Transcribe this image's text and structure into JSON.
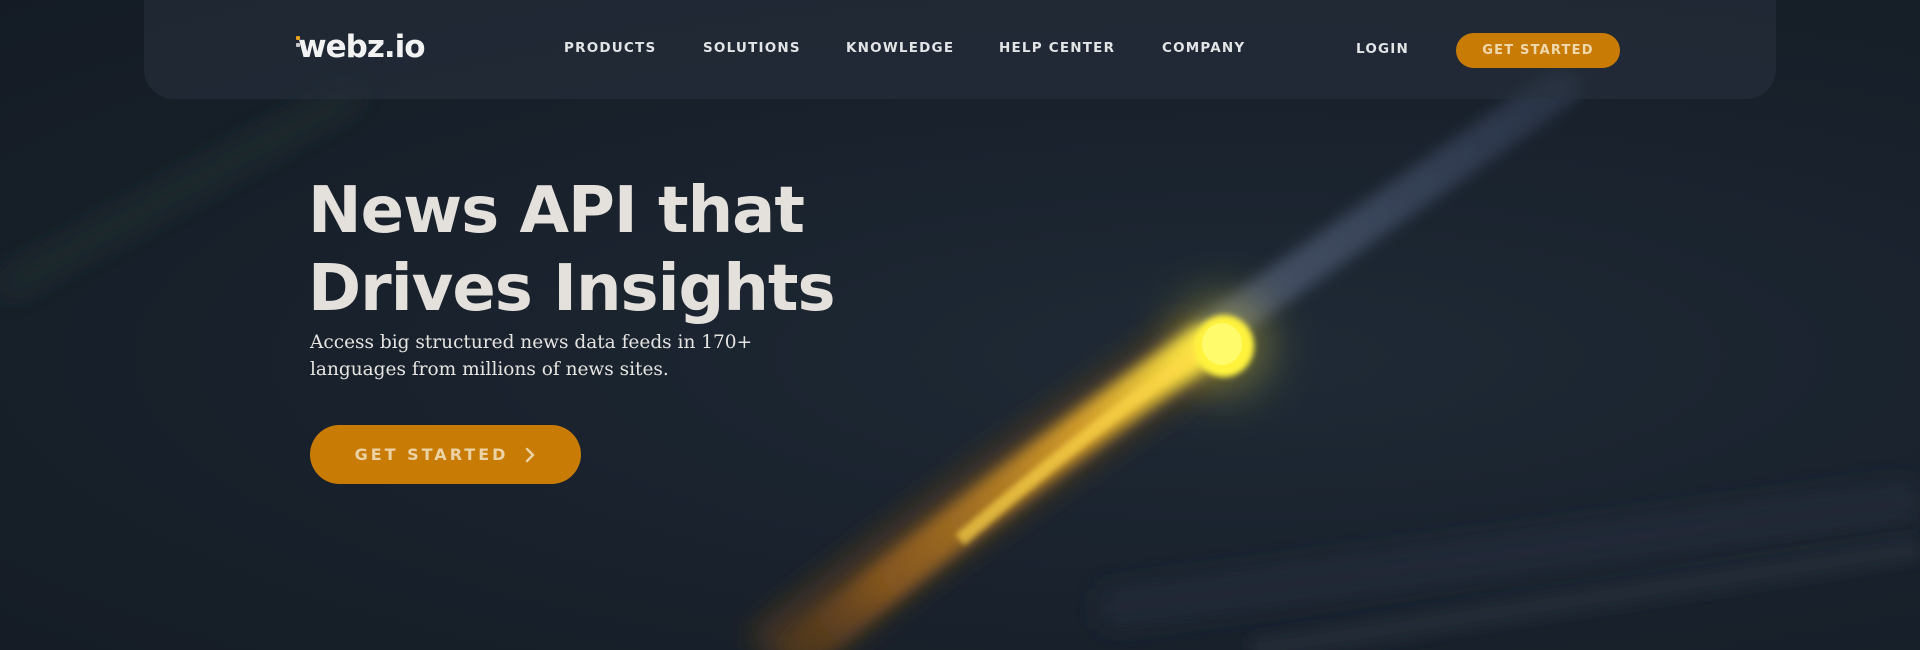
{
  "header": {
    "logo_text": "webz.io",
    "nav": [
      {
        "label": "PRODUCTS"
      },
      {
        "label": "SOLUTIONS"
      },
      {
        "label": "KNOWLEDGE"
      },
      {
        "label": "HELP CENTER"
      },
      {
        "label": "COMPANY"
      }
    ],
    "login_label": "LOGIN",
    "cta_label": "GET STARTED"
  },
  "hero": {
    "title_line1": "News API that",
    "title_line2": "Drives Insights",
    "subtitle": "Access big structured news data feeds in 170+ languages from millions of news sites.",
    "cta_label": "GET STARTED",
    "cta_icon": "chevron-right-icon"
  },
  "colors": {
    "background": "#17202b",
    "navbar": "#28323e",
    "accent": "#c87b05",
    "accent_text": "#ecd3a6",
    "light_streak": "#fff23a",
    "text_primary": "#e4e0dc"
  }
}
